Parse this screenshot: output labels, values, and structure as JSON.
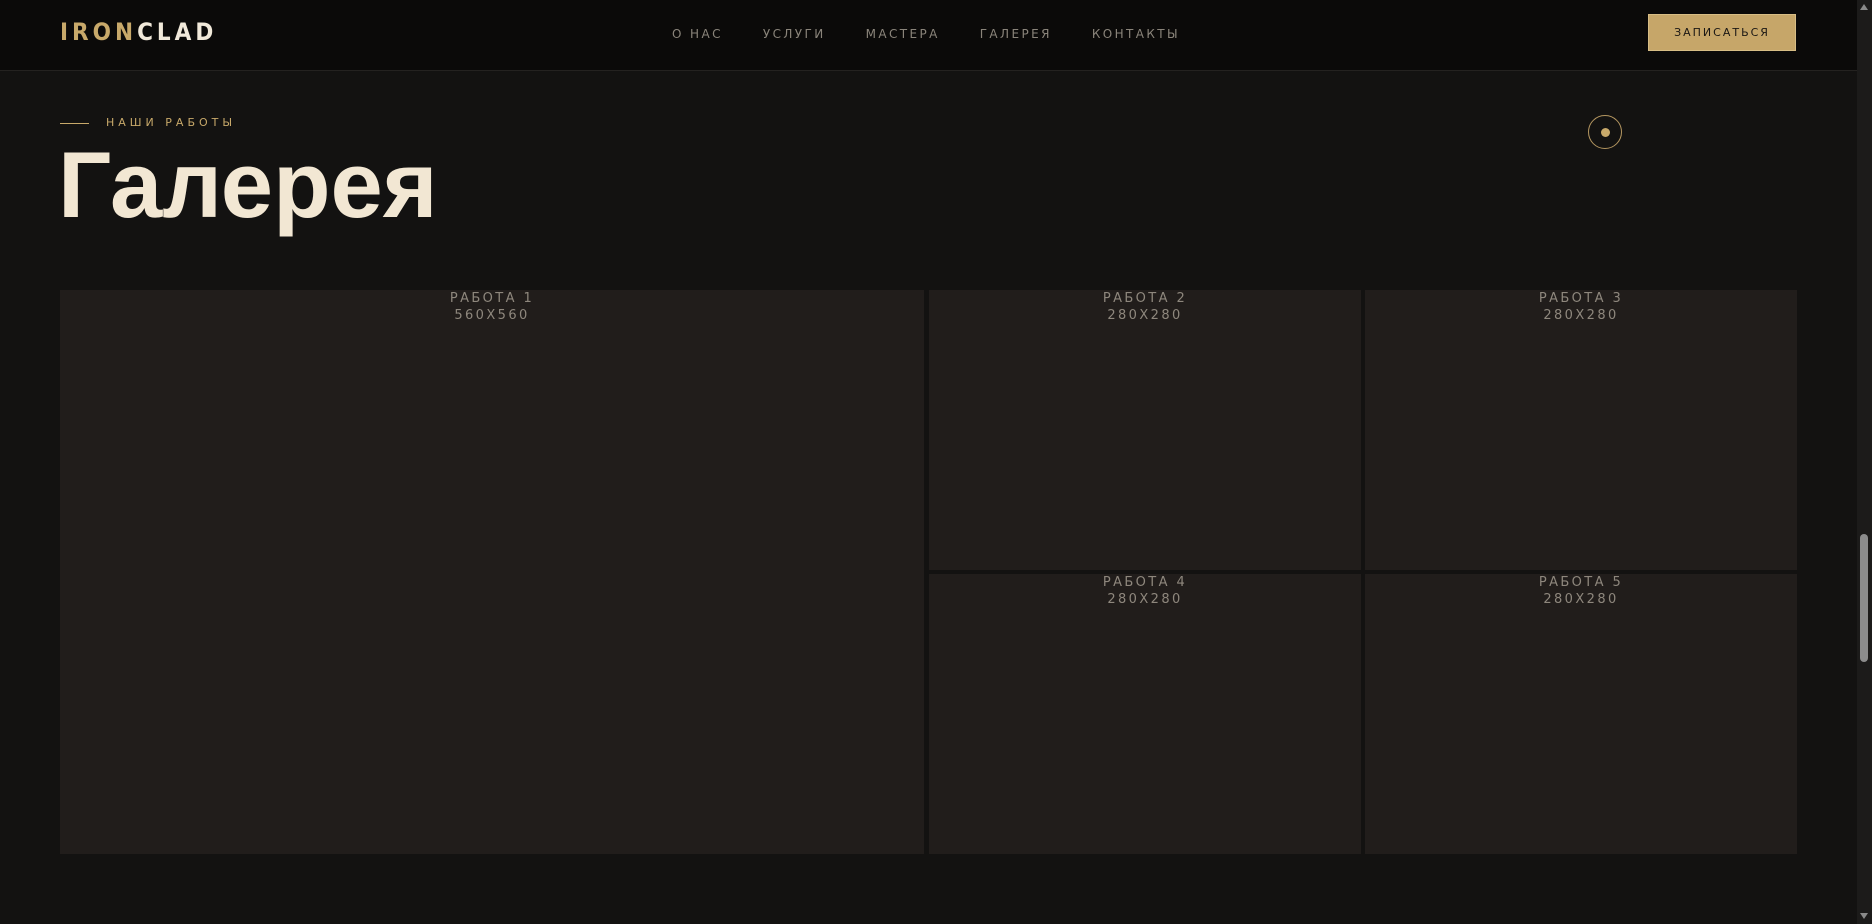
{
  "header": {
    "logo_part1": "IRON",
    "logo_part2": "CLAD",
    "nav": [
      "О НАС",
      "УСЛУГИ",
      "МАСТЕРА",
      "ГАЛЕРЕЯ",
      "КОНТАКТЫ"
    ],
    "cta_label": "ЗАПИСАТЬСЯ"
  },
  "section": {
    "eyebrow": "НАШИ РАБОТЫ",
    "title": "Галерея"
  },
  "gallery": [
    {
      "title": "РАБОТА 1",
      "size": "560X560"
    },
    {
      "title": "РАБОТА 2",
      "size": "280X280"
    },
    {
      "title": "РАБОТА 3",
      "size": "280X280"
    },
    {
      "title": "РАБОТА 4",
      "size": "280X280"
    },
    {
      "title": "РАБОТА 5",
      "size": "280X280"
    }
  ],
  "colors": {
    "accent": "#c8a96a",
    "background": "#131211",
    "header_bg": "#0b0a09",
    "tile_bg": "#211d1b",
    "title_text": "#f2e7d3"
  }
}
